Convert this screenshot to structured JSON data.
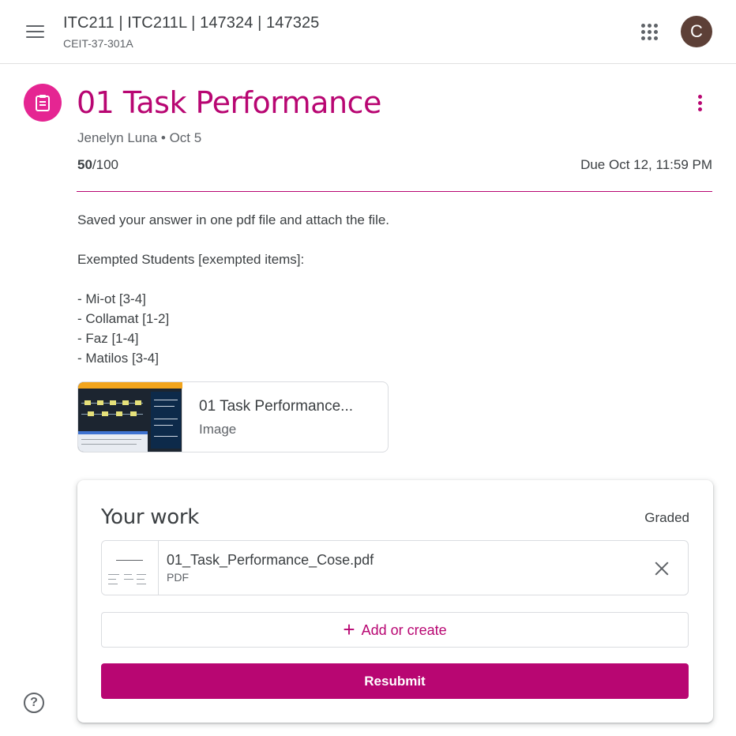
{
  "header": {
    "course_title": "ITC211 | ITC211L | 147324 | 147325",
    "course_section": "CEIT-37-301A",
    "avatar_letter": "C"
  },
  "assignment": {
    "title": "01 Task Performance",
    "author": "Jenelyn Luna",
    "separator": "•",
    "posted": "Oct 5",
    "points_earned": "50",
    "points_total": "/100",
    "due": "Due Oct 12, 11:59 PM",
    "description": {
      "line1": "Saved your answer in one pdf file and attach the file.",
      "line2": "Exempted Students [exempted items]:",
      "items": [
        "- Mi-ot [3-4]",
        "- Collamat [1-2]",
        "- Faz [1-4]",
        "- Matilos [3-4]"
      ]
    },
    "attachment": {
      "title": "01 Task Performance...",
      "type": "Image"
    }
  },
  "your_work": {
    "title": "Your work",
    "status": "Graded",
    "file": {
      "name": "01_Task_Performance_Cose.pdf",
      "type": "PDF"
    },
    "add_label": "Add or create",
    "add_symbol": "+",
    "resubmit_label": "Resubmit"
  },
  "help_symbol": "?",
  "colors": {
    "accent": "#b80672",
    "assignment_icon_bg": "#e52592",
    "avatar_bg": "#5d4037"
  }
}
